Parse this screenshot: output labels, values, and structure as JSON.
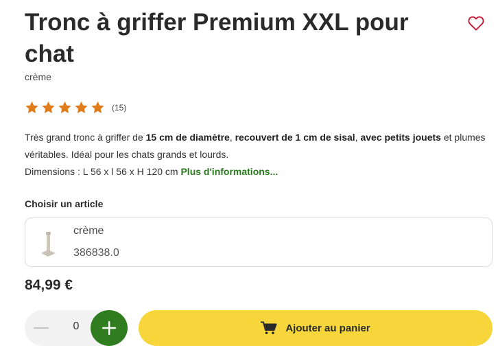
{
  "product": {
    "title": "Tronc à griffer Premium XXL pour chat",
    "variant": "crème",
    "rating": 5,
    "rating_count": "(15)"
  },
  "description": {
    "part1": "Très grand tronc à griffer de ",
    "bold1": "15 cm de diamètre",
    "part2": ", ",
    "bold2": "recouvert de 1 cm de sisal",
    "part3": ", ",
    "bold3": "avec petits jouets",
    "part4": " et plumes véritables. Idéal pour les chats grands et lourds.",
    "dimensions": "Dimensions : L 56 x l 56 x H 120 cm",
    "more_link": "Plus d'informations..."
  },
  "article_selector": {
    "label": "Choisir un article",
    "selected": {
      "name": "crème",
      "code": "386838.0"
    }
  },
  "price": "84,99 €",
  "quantity": {
    "value": "0"
  },
  "add_to_cart_label": "Ajouter au panier",
  "colors": {
    "star": "#e07b1c",
    "accent_green": "#2f7d1f",
    "cart_yellow": "#f7d63c",
    "wishlist_red": "#c8102e"
  },
  "icons": [
    "heart-icon",
    "star-icon",
    "minus-icon",
    "plus-icon",
    "cart-icon"
  ]
}
